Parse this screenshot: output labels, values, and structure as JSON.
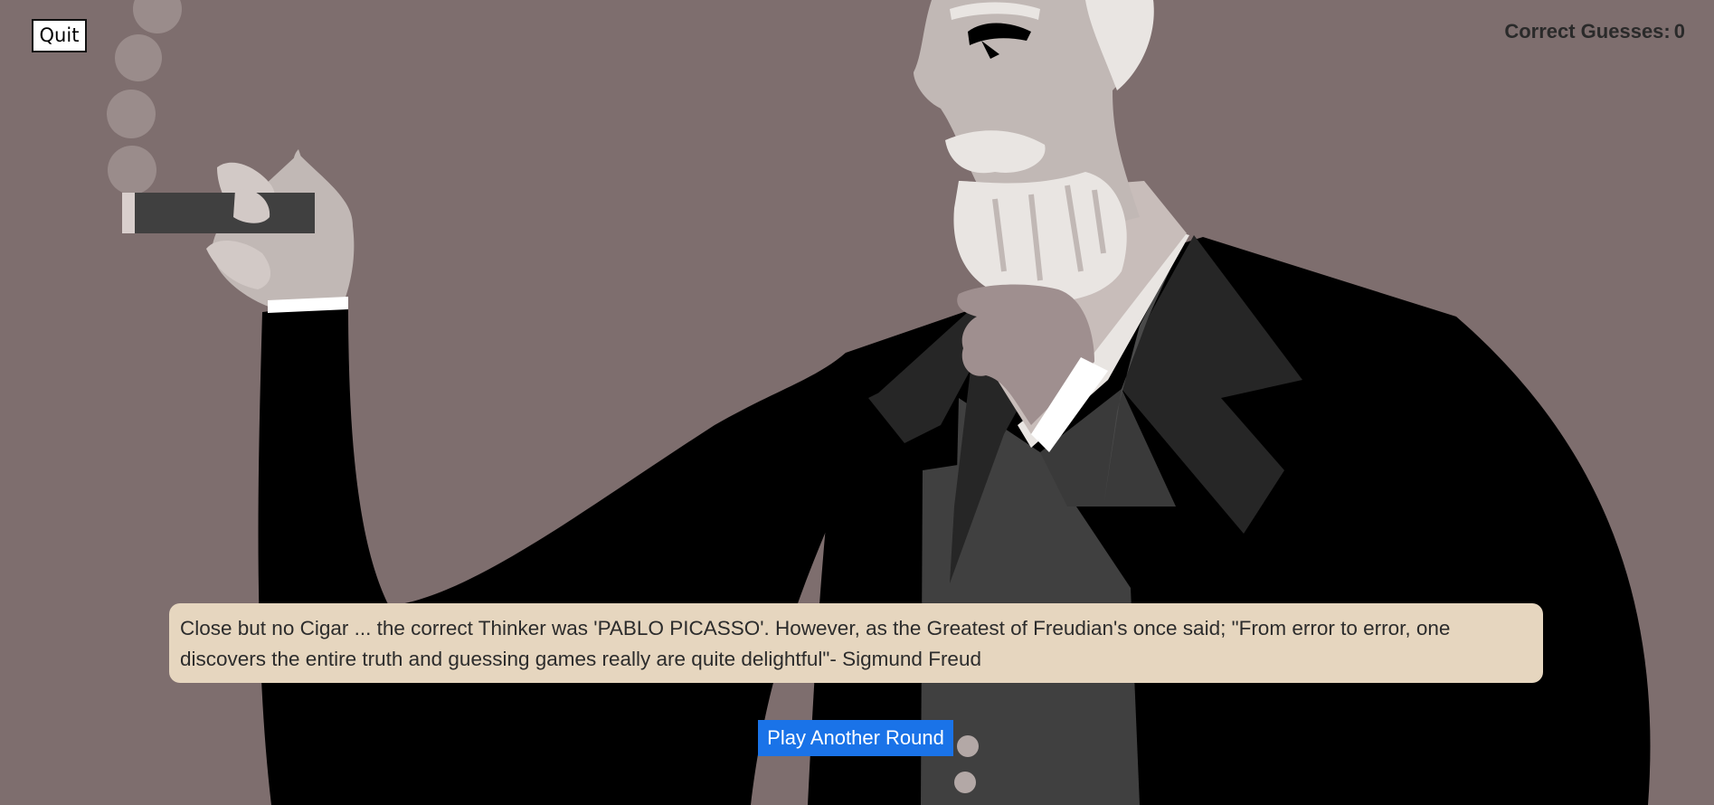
{
  "header": {
    "quit_label": "Quit",
    "score_label": "Correct Guesses:",
    "score_value": "0"
  },
  "result": {
    "message": "Close but no Cigar ... the correct Thinker was 'PABLO PICASSO'. However, as the Greatest of Freudian's once said; \"From error to error, one discovers the entire truth and guessing games really are quite delightful\"- Sigmund Freud"
  },
  "actions": {
    "play_again_label": "Play Another Round"
  },
  "colors": {
    "background": "#7e6e6e",
    "message_box": "#e6d6bf",
    "play_button": "#1a73e8",
    "suit": "#000000",
    "beard": "#e9e5e2"
  },
  "illustration": {
    "subject": "freud-with-cigar"
  }
}
